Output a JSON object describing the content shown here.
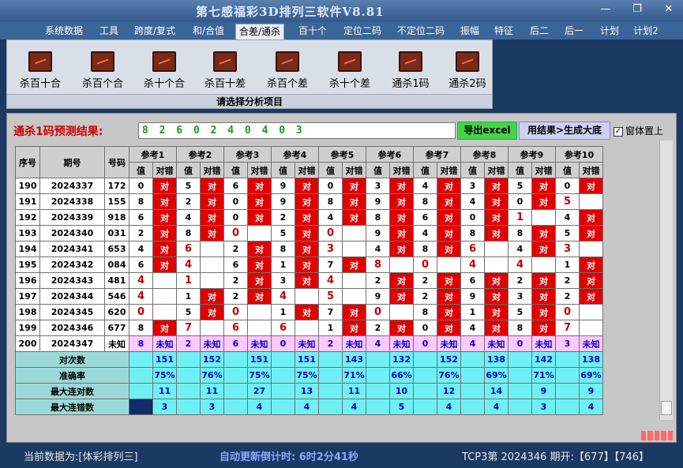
{
  "app": {
    "title": "第七感福彩3D排列三软件V8.81"
  },
  "menu": [
    "系统数据",
    "工具",
    "跨度/复式",
    "和/合值",
    "合差/通杀",
    "百十个",
    "定位二码",
    "不定位二码",
    "振幅",
    "特征",
    "后二",
    "后一",
    "计划",
    "计划2"
  ],
  "ribbon": {
    "buttons": [
      "杀百十合",
      "杀百个合",
      "杀十个合",
      "杀百十差",
      "杀百个差",
      "杀十个差",
      "通杀1码",
      "通杀2码"
    ],
    "caption": "请选择分析项目"
  },
  "prediction": {
    "label": "通杀1码预测结果:",
    "value": "8 2 6 0 2 4 0 4 0 3",
    "export_label": "导出excel",
    "generate_label": "用结果>生成大底",
    "on_top_label": "窗体置上"
  },
  "table": {
    "headers": {
      "seq": "序号",
      "period": "期号",
      "number": "号码",
      "val": "值",
      "hit": "对错"
    },
    "refs": [
      "参考1",
      "参考2",
      "参考3",
      "参考4",
      "参考5",
      "参考6",
      "参考7",
      "参考8",
      "参考9",
      "参考10"
    ],
    "rows": [
      {
        "seq": "190",
        "period": "2024337",
        "number": "172",
        "vals": [
          "0",
          "5",
          "6",
          "9",
          "0",
          "3",
          "4",
          "3",
          "5",
          "0"
        ],
        "hits": [
          "对",
          "对",
          "对",
          "对",
          "对",
          "对",
          "对",
          "对",
          "对",
          "对"
        ]
      },
      {
        "seq": "191",
        "period": "2024338",
        "number": "155",
        "vals": [
          "8",
          "2",
          "0",
          "9",
          "8",
          "9",
          "8",
          "4",
          "0",
          "5"
        ],
        "hits": [
          "对",
          "对",
          "对",
          "对",
          "对",
          "对",
          "对",
          "对",
          "对",
          ""
        ]
      },
      {
        "seq": "192",
        "period": "2024339",
        "number": "918",
        "vals": [
          "6",
          "4",
          "0",
          "2",
          "4",
          "8",
          "6",
          "0",
          "1",
          "4"
        ],
        "hits": [
          "对",
          "对",
          "对",
          "对",
          "对",
          "对",
          "对",
          "对",
          "",
          "对"
        ]
      },
      {
        "seq": "193",
        "period": "2024340",
        "number": "031",
        "vals": [
          "2",
          "8",
          "0",
          "5",
          "0",
          "9",
          "4",
          "8",
          "8",
          "5"
        ],
        "hits": [
          "对",
          "对",
          "",
          "对",
          "",
          "对",
          "对",
          "对",
          "对",
          "对"
        ]
      },
      {
        "seq": "194",
        "period": "2024341",
        "number": "653",
        "vals": [
          "4",
          "6",
          "2",
          "8",
          "3",
          "4",
          "8",
          "6",
          "4",
          "3"
        ],
        "hits": [
          "对",
          "",
          "对",
          "对",
          "",
          "对",
          "对",
          "",
          "对",
          ""
        ]
      },
      {
        "seq": "195",
        "period": "2024342",
        "number": "084",
        "vals": [
          "6",
          "4",
          "6",
          "1",
          "7",
          "8",
          "0",
          "4",
          "4",
          "1"
        ],
        "hits": [
          "对",
          "",
          "对",
          "对",
          "对",
          "",
          "",
          "",
          "",
          "对"
        ]
      },
      {
        "seq": "196",
        "period": "2024343",
        "number": "481",
        "vals": [
          "4",
          "1",
          "2",
          "3",
          "4",
          "2",
          "2",
          "6",
          "2",
          "2"
        ],
        "hits": [
          "",
          "",
          "对",
          "对",
          "",
          "对",
          "对",
          "对",
          "对",
          "对"
        ]
      },
      {
        "seq": "197",
        "period": "2024344",
        "number": "546",
        "vals": [
          "4",
          "1",
          "2",
          "4",
          "5",
          "9",
          "2",
          "9",
          "3",
          "2"
        ],
        "hits": [
          "",
          "对",
          "对",
          "",
          "",
          "对",
          "对",
          "对",
          "对",
          "对"
        ]
      },
      {
        "seq": "198",
        "period": "2024345",
        "number": "620",
        "vals": [
          "0",
          "5",
          "0",
          "1",
          "7",
          "0",
          "8",
          "1",
          "5",
          "0"
        ],
        "hits": [
          "",
          "对",
          "",
          "对",
          "对",
          "",
          "对",
          "对",
          "对",
          ""
        ]
      },
      {
        "seq": "199",
        "period": "2024346",
        "number": "677",
        "vals": [
          "8",
          "7",
          "6",
          "6",
          "1",
          "2",
          "0",
          "4",
          "8",
          "7"
        ],
        "hits": [
          "对",
          "",
          "",
          "",
          "对",
          "对",
          "对",
          "对",
          "对",
          ""
        ]
      },
      {
        "seq": "200",
        "period": "2024347",
        "number": "未知",
        "vals": [
          "8",
          "2",
          "6",
          "0",
          "2",
          "4",
          "0",
          "4",
          "0",
          "3"
        ],
        "hits": [
          "未知",
          "未知",
          "未知",
          "未知",
          "未知",
          "未知",
          "未知",
          "未知",
          "未知",
          "未知"
        ]
      }
    ],
    "stats": [
      {
        "label": "对次数",
        "values": [
          "151",
          "152",
          "151",
          "151",
          "143",
          "132",
          "152",
          "138",
          "142",
          "138"
        ]
      },
      {
        "label": "准确率",
        "values": [
          "75%",
          "76%",
          "75%",
          "75%",
          "71%",
          "66%",
          "76%",
          "69%",
          "71%",
          "69%"
        ]
      },
      {
        "label": "最大连对数",
        "values": [
          "11",
          "11",
          "27",
          "13",
          "11",
          "10",
          "12",
          "14",
          "9",
          "9"
        ]
      },
      {
        "label": "最大连错数",
        "values": [
          "3",
          "3",
          "4",
          "4",
          "4",
          "5",
          "4",
          "4",
          "3",
          "4"
        ]
      }
    ]
  },
  "status": {
    "current_data": "当前数据为:[体彩排列三]",
    "countdown": "自动更新倒计时:  6时2分41秒",
    "last_draw": "TCP3第 2024346 期开:【677】【746】"
  }
}
